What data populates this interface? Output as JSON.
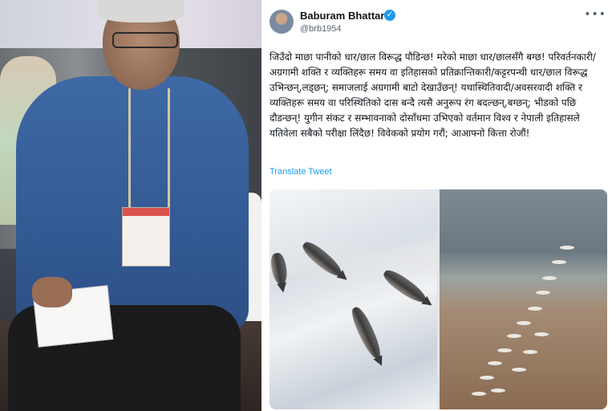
{
  "tweet": {
    "display_name": "Baburam Bhattarai",
    "handle": "@brb1954",
    "text": "जिउँदो माछा पानीको धार/छाल विरूद्ध पौडिन्छ! मरेको माछा धार/छालसँगै बग्छ! परिवर्तनकारी/अग्रगामी शक्ति र व्यक्तिहरू समय वा इतिहासको प्रतिक्रान्तिकारी/कट्टरपन्थी धार/छाल विरूद्ध उभिन्छन्,लड्छन्; समाजलाई अग्रगामी बाटो देखाउँछन्! यथास्थितिवादी/अवसरवादी शक्ति र व्यक्तिहरू समय वा परिस्थितिको दास बन्दै त्यसै अनुरूप रंग बदल्छन्,बग्छन्; भीडको पछि दौडन्छन्! युगीन संकट र सम्भावनाको दोसाँधमा उभिएको वर्तमान विश्व र नेपाली इतिहासले यतिवेला सबैको परीक्षा लिंदैछ! विवेकको प्रयोग गरौं; आआफ्नो कित्ता रोजौं!",
    "translate_label": "Translate Tweet",
    "more_icon": "more-icon",
    "verified_icon": "verified-badge-icon",
    "accent_color": "#1d9bf0"
  }
}
